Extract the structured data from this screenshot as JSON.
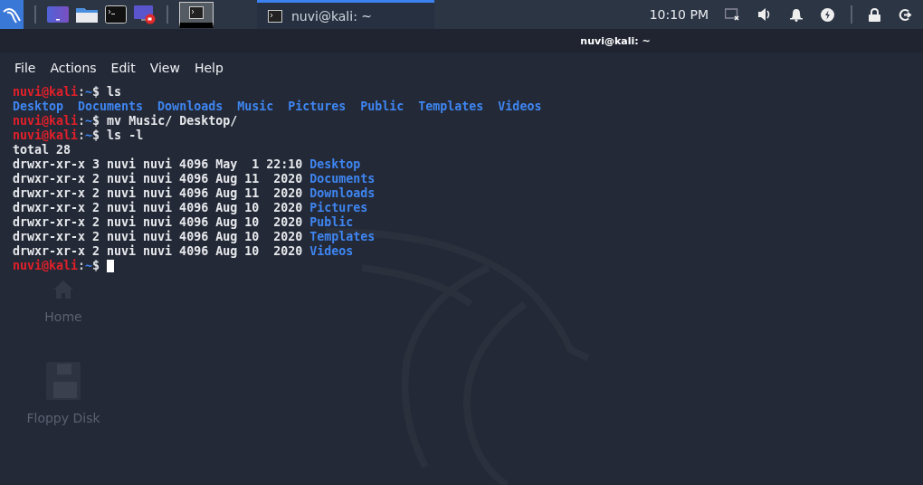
{
  "taskbar": {
    "launchers": [
      {
        "kind": "desktop"
      },
      {
        "kind": "folder"
      },
      {
        "kind": "terminal"
      },
      {
        "kind": "recorder"
      }
    ],
    "workspaces": [
      {
        "selected": true
      }
    ],
    "tasks": [
      {
        "title": "nuvi@kali: ~",
        "selected": true
      }
    ],
    "clock": "10:10 PM"
  },
  "desktop_icons": [
    {
      "kind": "home",
      "label": "Home"
    },
    {
      "kind": "floppy",
      "label": "Floppy Disk"
    }
  ],
  "window": {
    "title": "nuvi@kali: ~"
  },
  "menu": [
    "File",
    "Actions",
    "Edit",
    "View",
    "Help"
  ],
  "terminal": {
    "lines": [
      {
        "kind": "prompt",
        "user_host": "nuvi@kali",
        "separator": ":",
        "path": "~",
        "symbol": "$",
        "command": "ls"
      },
      {
        "kind": "listing",
        "entries": [
          "Desktop",
          "Documents",
          "Downloads",
          "Music",
          "Pictures",
          "Public",
          "Templates",
          "Videos"
        ]
      },
      {
        "kind": "prompt",
        "user_host": "nuvi@kali",
        "separator": ":",
        "path": "~",
        "symbol": "$",
        "command": "mv Music/ Desktop/"
      },
      {
        "kind": "prompt",
        "user_host": "nuvi@kali",
        "separator": ":",
        "path": "~",
        "symbol": "$",
        "command": "ls -l"
      },
      {
        "kind": "text",
        "text": "total 28"
      },
      {
        "kind": "long_entry",
        "info": "drwxr-xr-x 3 nuvi nuvi 4096 May  1 22:10",
        "name": "Desktop"
      },
      {
        "kind": "long_entry",
        "info": "drwxr-xr-x 2 nuvi nuvi 4096 Aug 11  2020",
        "name": "Documents"
      },
      {
        "kind": "long_entry",
        "info": "drwxr-xr-x 2 nuvi nuvi 4096 Aug 11  2020",
        "name": "Downloads"
      },
      {
        "kind": "long_entry",
        "info": "drwxr-xr-x 2 nuvi nuvi 4096 Aug 10  2020",
        "name": "Pictures"
      },
      {
        "kind": "long_entry",
        "info": "drwxr-xr-x 2 nuvi nuvi 4096 Aug 10  2020",
        "name": "Public"
      },
      {
        "kind": "long_entry",
        "info": "drwxr-xr-x 2 nuvi nuvi 4096 Aug 10  2020",
        "name": "Templates"
      },
      {
        "kind": "long_entry",
        "info": "drwxr-xr-x 2 nuvi nuvi 4096 Aug 10  2020",
        "name": "Videos"
      },
      {
        "kind": "prompt",
        "user_host": "nuvi@kali",
        "separator": ":",
        "path": "~",
        "symbol": "$",
        "cursor": true
      }
    ]
  }
}
